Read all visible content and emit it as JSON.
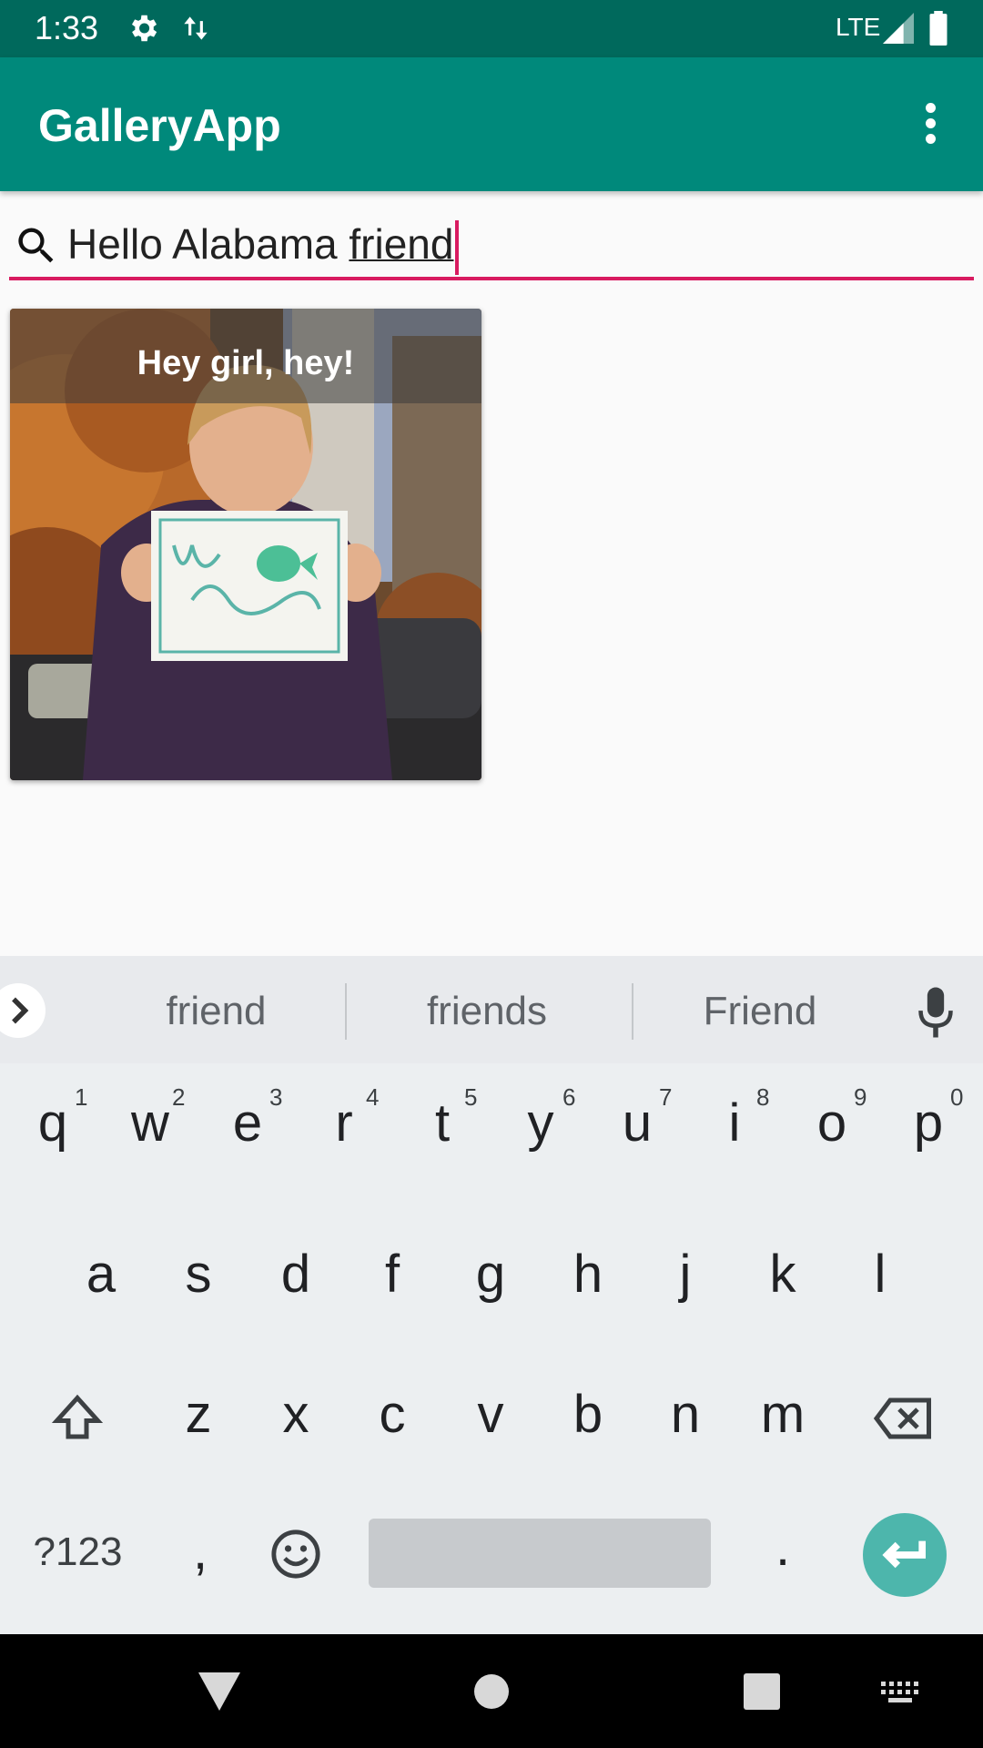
{
  "status_bar": {
    "time": "1:33",
    "network": "LTE",
    "icons": [
      "gear-icon",
      "data-arrows-icon",
      "signal-icon",
      "battery-icon"
    ]
  },
  "app_bar": {
    "title": "GalleryApp",
    "menu_icon": "overflow-menu-icon"
  },
  "search": {
    "icon": "search-icon",
    "text_before": "Hello Alabama ",
    "text_composing": "friend",
    "underline_color": "#d81b60"
  },
  "gallery": {
    "items": [
      {
        "caption": "Hey girl, hey!"
      }
    ]
  },
  "keyboard": {
    "suggestions": [
      "friend",
      "friends",
      "Friend"
    ],
    "row1": [
      {
        "key": "q",
        "hint": "1"
      },
      {
        "key": "w",
        "hint": "2"
      },
      {
        "key": "e",
        "hint": "3"
      },
      {
        "key": "r",
        "hint": "4"
      },
      {
        "key": "t",
        "hint": "5"
      },
      {
        "key": "y",
        "hint": "6"
      },
      {
        "key": "u",
        "hint": "7"
      },
      {
        "key": "i",
        "hint": "8"
      },
      {
        "key": "o",
        "hint": "9"
      },
      {
        "key": "p",
        "hint": "0"
      }
    ],
    "row2": [
      "a",
      "s",
      "d",
      "f",
      "g",
      "h",
      "j",
      "k",
      "l"
    ],
    "row3": [
      "z",
      "x",
      "c",
      "v",
      "b",
      "n",
      "m"
    ],
    "symbols_label": "?123",
    "comma": ",",
    "period": "."
  },
  "colors": {
    "status_bar": "#00695c",
    "app_bar": "#00897b",
    "accent": "#d81b60",
    "enter_key": "#4db6ac"
  }
}
